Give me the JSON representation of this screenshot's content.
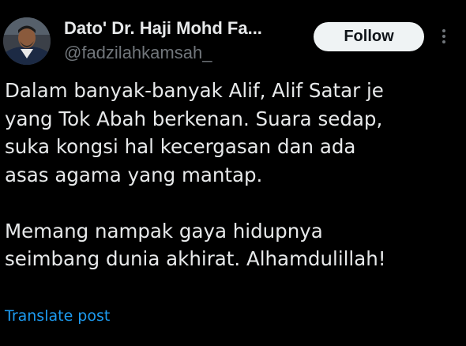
{
  "author": {
    "display_name": "Dato' Dr. Haji Mohd Fa...",
    "handle": "@fadzilahkamsah_",
    "avatar_icon": "profile-photo"
  },
  "actions": {
    "follow_label": "Follow",
    "more_icon": "more-vertical-icon"
  },
  "tweet": {
    "paragraphs": [
      "Dalam banyak-banyak Alif, Alif Satar je\nyang Tok Abah berkenan. Suara sedap,\nsuka kongsi hal kecergasan dan ada\nasas agama yang mantap.",
      "Memang nampak gaya hidupnya\nseimbang dunia akhirat. Alhamdulillah!"
    ]
  },
  "translate_label": "Translate post",
  "colors": {
    "background": "#000000",
    "primary_text": "#e7e9ea",
    "secondary_text": "#71767b",
    "link": "#1d9bf0",
    "follow_bg": "#eff3f4"
  }
}
